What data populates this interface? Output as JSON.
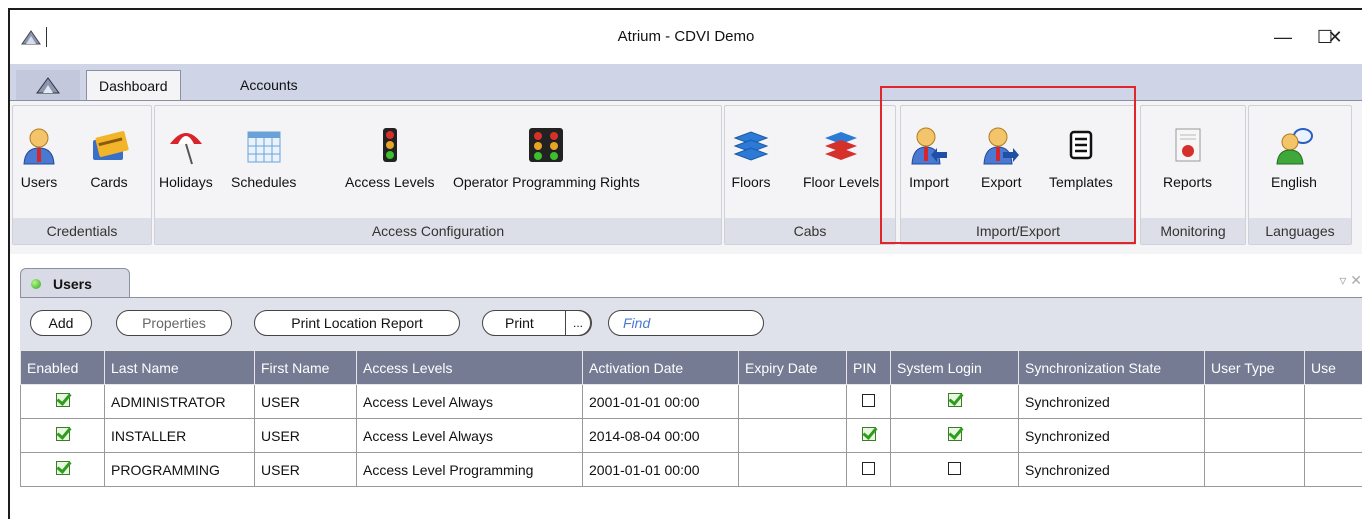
{
  "window": {
    "title": "Atrium - CDVI Demo",
    "minimize": "—",
    "maximize": "☐",
    "close": "✕"
  },
  "ribbon": {
    "tabs": [
      "Dashboard",
      "Accounts"
    ],
    "groups": [
      {
        "label": "Credentials",
        "buttons": [
          {
            "label": "Users",
            "icon": "user-icon"
          },
          {
            "label": "Cards",
            "icon": "card-icon"
          }
        ]
      },
      {
        "label": "Access Configuration",
        "buttons": [
          {
            "label": "Holidays",
            "icon": "parasol-icon"
          },
          {
            "label": "Schedules",
            "icon": "calendar-icon"
          },
          {
            "label": "Access Levels",
            "icon": "traffic-light-icon"
          },
          {
            "label": "Operator Programming Rights",
            "icon": "traffic-lights-group-icon"
          }
        ]
      },
      {
        "label": "Cabs",
        "buttons": [
          {
            "label": "Floors",
            "icon": "floors-icon"
          },
          {
            "label": "Floor Levels",
            "icon": "floor-levels-icon"
          }
        ]
      },
      {
        "label": "Import/Export",
        "buttons": [
          {
            "label": "Import",
            "icon": "import-user-icon"
          },
          {
            "label": "Export",
            "icon": "export-user-icon"
          },
          {
            "label": "Templates",
            "icon": "template-icon"
          }
        ]
      },
      {
        "label": "Monitoring",
        "buttons": [
          {
            "label": "Reports",
            "icon": "report-icon"
          }
        ]
      },
      {
        "label": "Languages",
        "buttons": [
          {
            "label": "English",
            "icon": "language-icon"
          }
        ]
      }
    ]
  },
  "panel": {
    "tab_label": "Users",
    "status_color": "#2ea51b",
    "controls": "▿ ✕"
  },
  "toolbar": {
    "add": "Add",
    "properties": "Properties",
    "print_location_report": "Print Location Report",
    "print": "Print",
    "more": "...",
    "find_placeholder": "Find"
  },
  "table": {
    "columns": [
      "Enabled",
      "Last Name",
      "First Name",
      "Access Levels",
      "Activation Date",
      "Expiry Date",
      "PIN",
      "System Login",
      "Synchronization State",
      "User Type",
      "Use"
    ],
    "rows": [
      {
        "enabled": true,
        "last_name": "ADMINISTRATOR",
        "first_name": "USER",
        "access_levels": "Access Level Always",
        "activation_date": "2001-01-01 00:00",
        "expiry_date": "",
        "pin": false,
        "system_login": true,
        "sync_state": "Synchronized",
        "user_type": ""
      },
      {
        "enabled": true,
        "last_name": "INSTALLER",
        "first_name": "USER",
        "access_levels": "Access Level Always",
        "activation_date": "2014-08-04 00:00",
        "expiry_date": "",
        "pin": true,
        "system_login": true,
        "sync_state": "Synchronized",
        "user_type": ""
      },
      {
        "enabled": true,
        "last_name": "PROGRAMMING",
        "first_name": "USER",
        "access_levels": "Access Level Programming",
        "activation_date": "2001-01-01 00:00",
        "expiry_date": "",
        "pin": false,
        "system_login": false,
        "sync_state": "Synchronized",
        "user_type": ""
      }
    ]
  },
  "colors": {
    "accent_highlight": "#e0262b",
    "header_bg": "#747b93",
    "ribbon_bg": "#cfd4e6"
  }
}
